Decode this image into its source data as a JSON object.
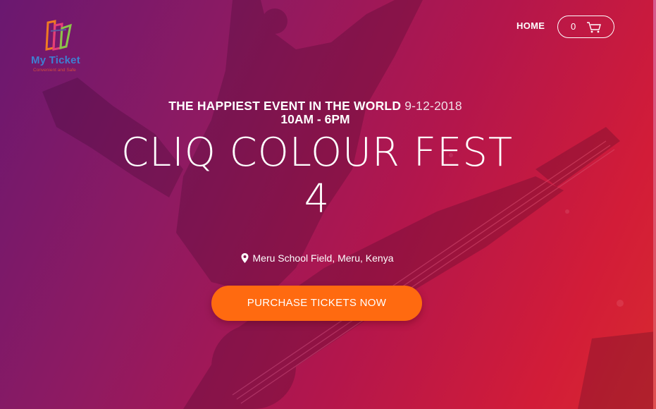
{
  "brand": {
    "name": "My Ticket",
    "tagline": "Convenient and Safe",
    "logo_icon": "ticket-stack-icon"
  },
  "nav": {
    "home_label": "HOME",
    "cart_count": "0",
    "cart_icon": "shopping-cart-icon"
  },
  "event": {
    "headline": "THE HAPPIEST EVENT IN THE WORLD",
    "date": "9-12-2018",
    "time": "10AM - 6PM",
    "title_line1": "CLIQ COLOUR FEST",
    "title_line2": "4",
    "location": "Meru School Field, Meru, Kenya",
    "location_icon": "map-pin-icon"
  },
  "cta": {
    "label": "PURCHASE TICKETS NOW"
  },
  "colors": {
    "gradient_start": "#6a1870",
    "gradient_end": "#d82a2f",
    "cta": "#ff6a10",
    "brand_blue": "#3f7fd1",
    "text": "#ffffff"
  }
}
